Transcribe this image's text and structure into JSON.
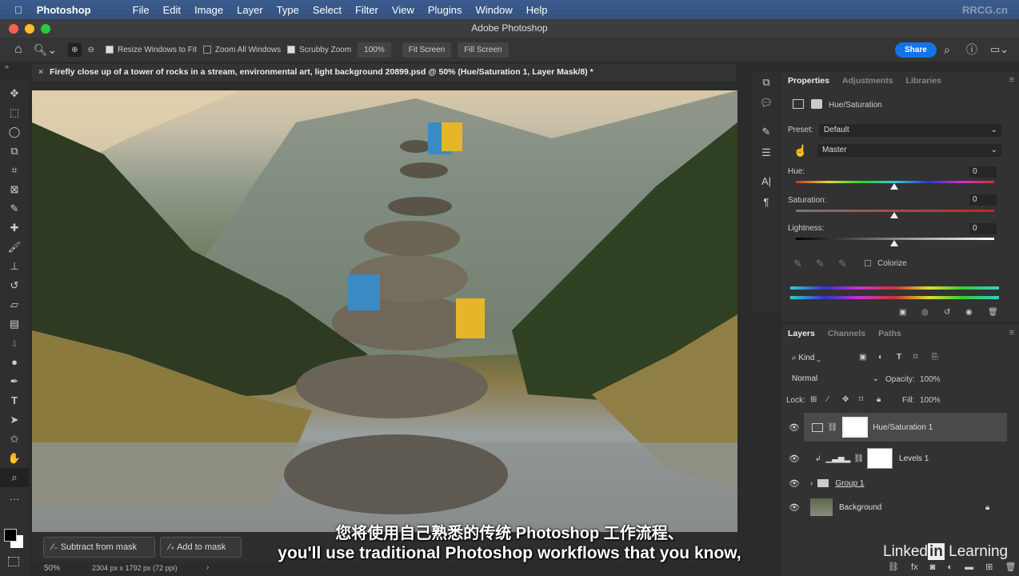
{
  "menubar": {
    "app": "Photoshop",
    "items": [
      "File",
      "Edit",
      "Image",
      "Layer",
      "Type",
      "Select",
      "Filter",
      "View",
      "Plugins",
      "Window",
      "Help"
    ]
  },
  "window_title": "Adobe Photoshop",
  "options": {
    "resize_windows": "Resize Windows to Fit",
    "resize_checked": true,
    "zoom_all": "Zoom All Windows",
    "zoom_all_checked": false,
    "scrubby": "Scrubby Zoom",
    "scrubby_checked": true,
    "zoom_pct": "100%",
    "fit_screen": "Fit Screen",
    "fill_screen": "Fill Screen",
    "share": "Share"
  },
  "document_tab": "Firefly close up of a tower of rocks in a stream, environmental art, light background 20899.psd @ 50% (Hue/Saturation 1, Layer Mask/8) *",
  "mask_bar": {
    "subtract": "Subtract from mask",
    "add": "Add to mask"
  },
  "status": {
    "zoom": "50%",
    "dimensions": "2304 px x 1792 px (72 ppi)"
  },
  "properties": {
    "tabs": [
      "Properties",
      "Adjustments",
      "Libraries"
    ],
    "adjustment": "Hue/Saturation",
    "preset_label": "Preset:",
    "preset": "Default",
    "channel": "Master",
    "hue_label": "Hue:",
    "hue": "0",
    "saturation_label": "Saturation:",
    "saturation": "0",
    "lightness_label": "Lightness:",
    "lightness": "0",
    "colorize": "Colorize"
  },
  "layers": {
    "tabs": [
      "Layers",
      "Channels",
      "Paths"
    ],
    "filter": "Kind",
    "blend": "Normal",
    "opacity_label": "Opacity:",
    "opacity": "100%",
    "lock_label": "Lock:",
    "fill_label": "Fill:",
    "fill": "100%",
    "items": [
      {
        "name": "Hue/Saturation 1",
        "selected": true
      },
      {
        "name": "Levels 1"
      },
      {
        "name": "Group 1"
      },
      {
        "name": "Background",
        "locked": true
      }
    ]
  },
  "subtitles": {
    "zh": "您将使用自己熟悉的传统 Photoshop 工作流程、",
    "en": "you'll use traditional Photoshop workflows that you know,"
  },
  "branding": {
    "linkedin": "LinkedIn Learning",
    "watermark": "RRCG.cn"
  },
  "colors": {
    "accent": "#1473e6",
    "menubar": "#3b5c8f"
  }
}
